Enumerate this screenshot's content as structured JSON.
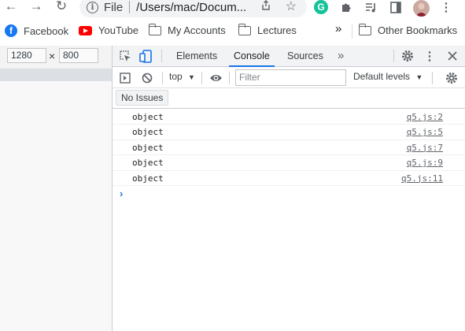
{
  "browser": {
    "omnibox": {
      "scheme_label": "File",
      "url": "/Users/mac/Docum..."
    }
  },
  "bookmarks": {
    "items": [
      {
        "label": "Facebook",
        "icon": "facebook-icon"
      },
      {
        "label": "YouTube",
        "icon": "youtube-icon"
      },
      {
        "label": "My Accounts",
        "icon": "folder-icon"
      },
      {
        "label": "Lectures",
        "icon": "folder-icon"
      }
    ],
    "overflow_label": "»",
    "other_label": "Other Bookmarks"
  },
  "device_toolbar": {
    "width": "1280",
    "height": "800",
    "separator": "×"
  },
  "devtools": {
    "tabs": [
      {
        "label": "Elements",
        "active": false
      },
      {
        "label": "Console",
        "active": true
      },
      {
        "label": "Sources",
        "active": false
      }
    ],
    "more_tabs": "»",
    "console_toolbar": {
      "context": "top",
      "filter_placeholder": "Filter",
      "levels": "Default levels"
    },
    "issues_button": "No Issues",
    "logs": [
      {
        "message": "object",
        "source": "q5.js:2"
      },
      {
        "message": "object",
        "source": "q5.js:5"
      },
      {
        "message": "object",
        "source": "q5.js:7"
      },
      {
        "message": "object",
        "source": "q5.js:9"
      },
      {
        "message": "object",
        "source": "q5.js:11"
      }
    ],
    "prompt": "›"
  },
  "colors": {
    "accent": "#1a73e8",
    "facebook": "#1877f2",
    "youtube": "#ff0000",
    "grammarly": "#15c39a"
  }
}
